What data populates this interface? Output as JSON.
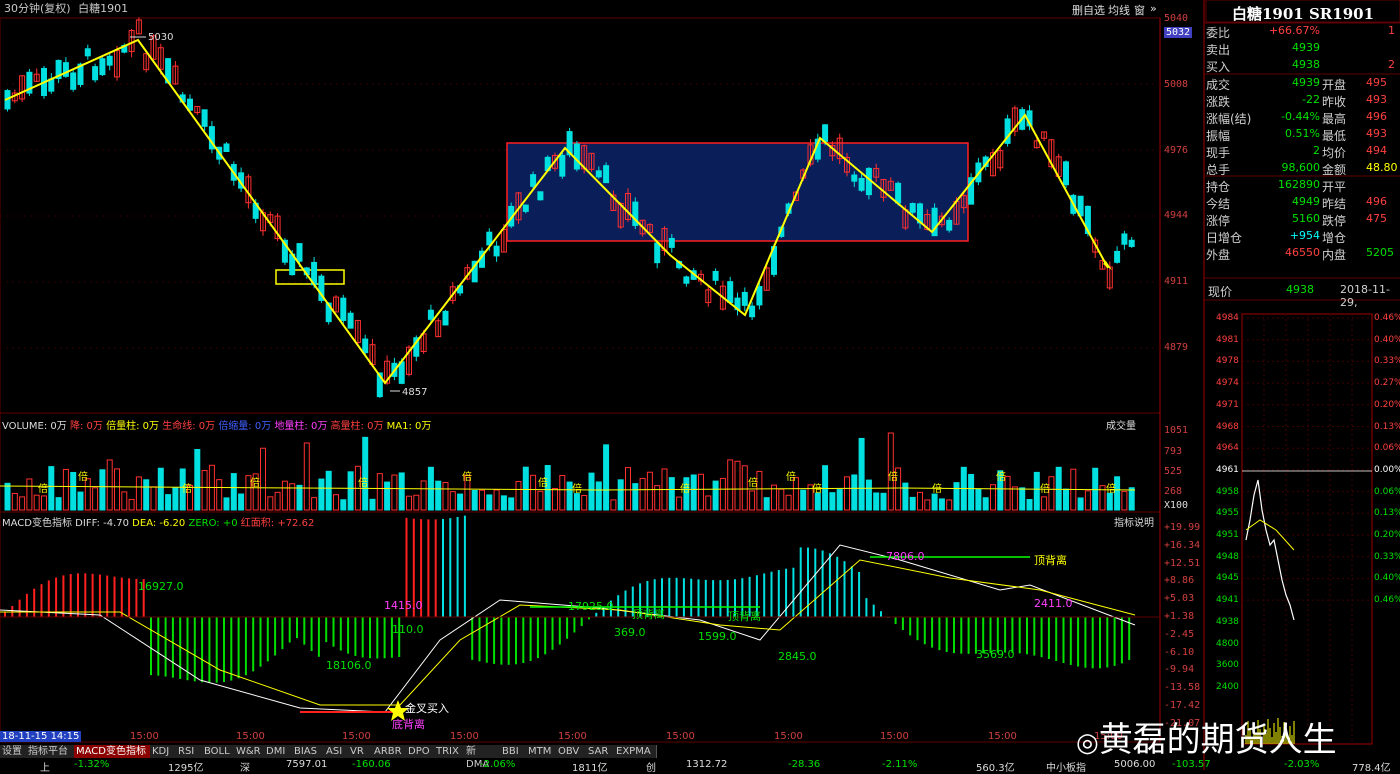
{
  "header": {
    "left_info": "30分钟(复权)",
    "symbol": "白糖1901",
    "buttons": [
      "删自选",
      "均线",
      "窗",
      "»"
    ]
  },
  "price_axis": [
    "5040",
    "5032",
    "5008",
    "4976",
    "4944",
    "4911",
    "4879"
  ],
  "price_marks": {
    "high": "5030",
    "low": "4857"
  },
  "volume_header": {
    "items": [
      "VOLUME: 0万",
      "降: 0万",
      "倍量柱: 0万",
      "生命线: 0万",
      "倍缩量: 0万",
      "地量柱: 0万",
      "高量柱: 0万",
      "MA1: 0万"
    ],
    "menu": "成交量"
  },
  "volume_axis": [
    "1051",
    "793",
    "525",
    "268",
    "X100"
  ],
  "volume_marker": "倍",
  "macd_header": {
    "title": "MACD变色指标",
    "diff": "DIFF: -4.70",
    "dea": "DEA: -6.20",
    "zero": "ZERO: +0",
    "area": "红面积: +72.62",
    "help": "指标说明"
  },
  "macd_axis": [
    "+19.99",
    "+16.34",
    "+12.51",
    "+8.86",
    "+5.03",
    "+1.38",
    "-2.45",
    "-6.10",
    "-9.94",
    "-13.58",
    "-17.42",
    "-21.07"
  ],
  "macd_annotations": [
    {
      "text": "16927.0",
      "color": "#00e000"
    },
    {
      "text": "1415.0",
      "color": "#ff40ff"
    },
    {
      "text": "110.0",
      "color": "#00e000"
    },
    {
      "text": "18106.0",
      "color": "#00e000"
    },
    {
      "text": "金叉买入",
      "color": "#ffffff"
    },
    {
      "text": "底背离",
      "color": "#ff40ff"
    },
    {
      "text": "17925.0",
      "color": "#00e000"
    },
    {
      "text": "顶背离",
      "color": "#00e000"
    },
    {
      "text": "369.0",
      "color": "#00e000"
    },
    {
      "text": "1599.0",
      "color": "#00e000"
    },
    {
      "text": "顶背离",
      "color": "#00e000"
    },
    {
      "text": "2845.0",
      "color": "#00e000"
    },
    {
      "text": "7806.0",
      "color": "#ff40ff"
    },
    {
      "text": "顶背离",
      "color": "#ffff00"
    },
    {
      "text": "2411.0",
      "color": "#ff40ff"
    },
    {
      "text": "3569.0",
      "color": "#00e000"
    }
  ],
  "x_axis": [
    "15:00",
    "15:00",
    "15:00",
    "15:00",
    "15:00",
    "15:00",
    "15:00",
    "15:00",
    "15:00",
    "15:00"
  ],
  "current_time_label": "18-11-15 14:15",
  "right_panel": {
    "title": "白糖1901 SR1901",
    "rows": [
      {
        "label": "委比",
        "value": "+66.67%",
        "extra": "1"
      },
      {
        "label": "卖出",
        "value": "4939",
        "extra": ""
      },
      {
        "label": "买入",
        "value": "4938",
        "extra": "2"
      },
      {
        "label": "成交",
        "value": "4939",
        "label2": "开盘",
        "value2": "495"
      },
      {
        "label": "涨跌",
        "value": "-22",
        "label2": "昨收",
        "value2": "493"
      },
      {
        "label": "涨幅(结)",
        "value": "-0.44%",
        "label2": "最高",
        "value2": "496"
      },
      {
        "label": "振幅",
        "value": "0.51%",
        "label2": "最低",
        "value2": "493"
      },
      {
        "label": "现手",
        "value": "2",
        "label2": "均价",
        "value2": "494"
      },
      {
        "label": "总手",
        "value": "98,600",
        "label2": "金额",
        "value2": "48.80"
      },
      {
        "label": "持仓",
        "value": "162890",
        "label2": "开平",
        "value2": ""
      },
      {
        "label": "今结",
        "value": "4949",
        "label2": "昨结",
        "value2": "496"
      },
      {
        "label": "涨停",
        "value": "5160",
        "label2": "跌停",
        "value2": "475"
      },
      {
        "label": "日增仓",
        "value": "+954",
        "label2": "增仓",
        "value2": ""
      },
      {
        "label": "外盘",
        "value": "46550",
        "label2": "内盘",
        "value2": "5205"
      }
    ],
    "now_label": "现价",
    "now_value": "4938",
    "now_date": "2018-11-29,",
    "mini_axis_left": [
      "4984",
      "4981",
      "4978",
      "4974",
      "4971",
      "4968",
      "4964",
      "4961",
      "4958",
      "4955",
      "4951",
      "4948",
      "4945",
      "4941",
      "4938",
      "4800",
      "3600",
      "2400"
    ],
    "mini_axis_right": [
      "0.46%",
      "0.40%",
      "0.33%",
      "0.27%",
      "0.20%",
      "0.13%",
      "0.06%",
      "0.00%",
      "0.06%",
      "0.13%",
      "0.20%",
      "0.33%",
      "0.40%",
      "0.46%"
    ]
  },
  "bottom_tabs": [
    "设置",
    "指标平台",
    "MACD变色指标",
    "KDJ",
    "RSI",
    "BOLL",
    "W&R",
    "DMI",
    "BIAS",
    "ASI",
    "VR",
    "ARBR",
    "DPO",
    "TRIX",
    "新DMA",
    "BBI",
    "MTM",
    "OBV",
    "SAR",
    "EXPMA"
  ],
  "status_bar": [
    "上",
    "-1.32%",
    "1295亿",
    "深",
    "7597.01",
    "-160.06",
    "-2.06%",
    "1811亿",
    "创",
    "1312.72",
    "-28.36",
    "-2.11%",
    "560.3亿",
    "中小板指",
    "5006.00",
    "-103.57",
    "-2.03%",
    "778.4亿"
  ],
  "watermark": "黄磊的期货人生"
}
